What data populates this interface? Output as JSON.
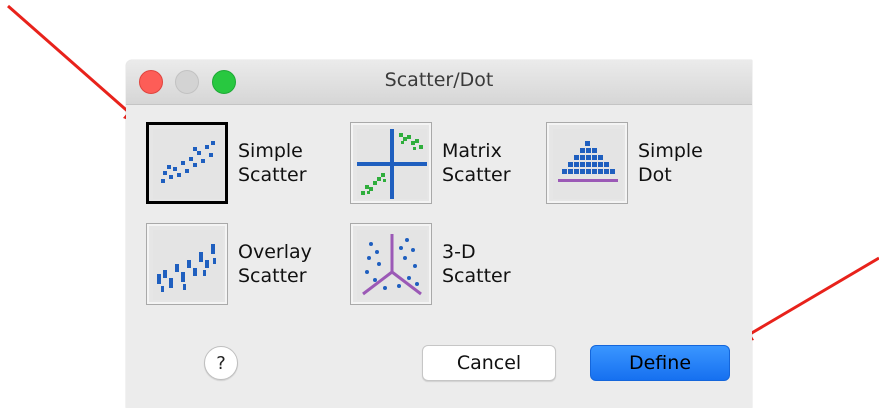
{
  "window": {
    "title": "Scatter/Dot"
  },
  "options": [
    {
      "line1": "Simple",
      "line2": "Scatter",
      "icon": "simple-scatter-icon",
      "selected": true
    },
    {
      "line1": "Matrix",
      "line2": "Scatter",
      "icon": "matrix-scatter-icon",
      "selected": false
    },
    {
      "line1": "Simple",
      "line2": "Dot",
      "icon": "simple-dot-icon",
      "selected": false
    },
    {
      "line1": "Overlay",
      "line2": "Scatter",
      "icon": "overlay-scatter-icon",
      "selected": false
    },
    {
      "line1": "3-D",
      "line2": "Scatter",
      "icon": "3d-scatter-icon",
      "selected": false
    }
  ],
  "buttons": {
    "help": "?",
    "cancel": "Cancel",
    "define": "Define"
  },
  "colors": {
    "arrow": "#e8221b",
    "icon_blue": "#1f5fbf",
    "icon_green": "#2fae3c",
    "icon_purple": "#9b59b6",
    "define_blue": "#1a78f2"
  }
}
